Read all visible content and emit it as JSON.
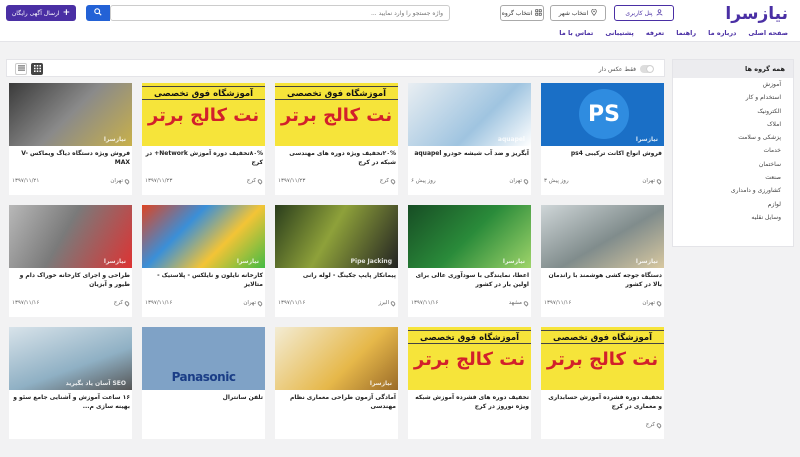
{
  "header": {
    "logo": "نیازسرا",
    "user_panel": "پنل کاربری",
    "select_city": "انتخاب شهر",
    "select_group": "انتخاب گروه",
    "search_placeholder": "واژه جستجو را وارد نمایید ...",
    "post_ad": "ارسال آگهی رایگان",
    "accent": "#4a2fa4",
    "search_button_color": "#2362d6"
  },
  "nav": [
    "صفحه اصلی",
    "درباره ما",
    "راهنما",
    "تعرفه",
    "پشتیبانی",
    "تماس با ما"
  ],
  "sidebar": {
    "title": "همه گروه ها",
    "categories": [
      "آموزش",
      "استخدام و کار",
      "الکترونیک",
      "املاک",
      "پزشکی و سلامت",
      "خدمات",
      "ساختمان",
      "صنعت",
      "کشاورزی و دامداری",
      "لوازم",
      "وسایل نقلیه"
    ]
  },
  "toolbar": {
    "toggle_label": "فقط عکس دار"
  },
  "cards": [
    {
      "title": "فروش انواع اکانت ترکیبی ps4",
      "city": "تهران",
      "date": "۳ روز پیش",
      "thumb": "ps",
      "thumb_text": "نیازسرا"
    },
    {
      "title": "آبگریز و ضد آب شیشه خودرو aquapel",
      "city": "تهران",
      "date": "۶ روز پیش",
      "thumb": "photo-h",
      "thumb_text": "aquapel"
    },
    {
      "title": "۲۰%تخفیف ویژه دوره های مهندسی شبکه در کرج",
      "city": "کرج",
      "date": "۱۳۹۷/۱۱/۲۳",
      "thumb": "yellow",
      "thumb_text": "آموزشگاه فوق تخصصی|نت کالج برتر"
    },
    {
      "title": "۸۰%تخفیف دوره آموزش Network+ در کرج",
      "city": "کرج",
      "date": "۱۳۹۷/۱۱/۲۳",
      "thumb": "yellow",
      "thumb_text": "آموزشگاه فوق تخصصی|نت کالج برتر"
    },
    {
      "title": "فروش ویژه دستگاه دیاگ ویماکس V-MAX",
      "city": "تهران",
      "date": "۱۳۹۷/۱۱/۲۱",
      "thumb": "photo-a",
      "thumb_text": "نیازسرا"
    },
    {
      "title": "دستگاه جوجه کشی هوشمند با راندمان بالا در کشور",
      "city": "تهران",
      "date": "۱۳۹۷/۱۱/۱۶",
      "thumb": "photo-g",
      "thumb_text": "نیازسرا"
    },
    {
      "title": "اعطا، نمایندگی با سودآوری عالی برای اولین بار در کشور",
      "city": "مشهد",
      "date": "۱۳۹۷/۱۱/۱۶",
      "thumb": "photo-f",
      "thumb_text": "نیازسرا"
    },
    {
      "title": "پیمانکار پایپ جکینگ - لوله رانی",
      "city": "البرز",
      "date": "۱۳۹۷/۱۱/۱۶",
      "thumb": "photo-e",
      "thumb_text": "Pipe Jacking"
    },
    {
      "title": "کارخانه نایلون و نایلکس - پلاستیک - متالایز",
      "city": "تهران",
      "date": "۱۳۹۷/۱۱/۱۶",
      "thumb": "photo-d",
      "thumb_text": "نیازسرا"
    },
    {
      "title": "طراحی و اجرای کارخانه خوراک دام و طیور و آبزیان",
      "city": "کرج",
      "date": "۱۳۹۷/۱۱/۱۶",
      "thumb": "photo-c",
      "thumb_text": "نیازسرا"
    },
    {
      "title": "تخفیف دوره فشرده آموزش حسابداری و معماری در کرج",
      "city": "کرج",
      "date": "",
      "thumb": "yellow",
      "thumb_text": "آموزشگاه فوق تخصصی|نت کالج برتر"
    },
    {
      "title": "تخفیف دوره های فشرده آموزش شبکه ویژه نوروز در کرج",
      "city": "",
      "date": "",
      "thumb": "yellow",
      "thumb_text": "آموزشگاه فوق تخصصی|نت کالج برتر"
    },
    {
      "title": "آمادگی آزمون طراحی معماری نظام مهندسی",
      "city": "",
      "date": "",
      "thumb": "photo-i",
      "thumb_text": "نیازسرا"
    },
    {
      "title": "تلفن سانترال",
      "city": "",
      "date": "",
      "thumb": "panasonic",
      "thumb_text": "Panasonic"
    },
    {
      "title": "۱۶ ساعت آموزش و آشنایی جامع سئو و بهینه سازی م...",
      "city": "",
      "date": "",
      "thumb": "photo-b",
      "thumb_text": "SEO آسان یاد بگیرید"
    }
  ]
}
